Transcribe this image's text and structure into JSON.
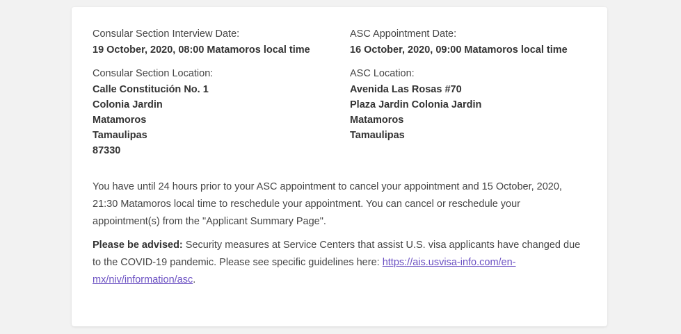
{
  "consular": {
    "interview_label": "Consular Section Interview Date:",
    "interview_value": "19 October, 2020, 08:00 Matamoros local time",
    "location_label": "Consular Section Location:",
    "address": [
      "Calle Constitución No. 1",
      "Colonia Jardin",
      "Matamoros",
      "Tamaulipas",
      "87330"
    ]
  },
  "asc": {
    "appointment_label": "ASC Appointment Date:",
    "appointment_value": "16 October, 2020, 09:00 Matamoros local time",
    "location_label": "ASC Location:",
    "address": [
      "Avenida Las Rosas #70",
      "Plaza Jardin Colonia Jardin",
      "Matamoros",
      "Tamaulipas"
    ]
  },
  "notice": {
    "text": "You have until 24 hours prior to your ASC appointment to cancel your appointment and 15 October, 2020, 21:30 Matamoros local time to reschedule your appointment. You can cancel or reschedule your appointment(s) from the \"Applicant Summary Page\"."
  },
  "advisory": {
    "bold_label": "Please be advised:",
    "text": " Security measures at Service Centers that assist U.S. visa applicants have changed due to the COVID-19 pandemic. Please see specific guidelines here: ",
    "link_text": "https://ais.usvisa-info.com/en-mx/niv/information/asc",
    "trailing": "."
  },
  "colors": {
    "link": "#6a4fc2",
    "background": "#f2f2f2",
    "card": "#ffffff"
  }
}
